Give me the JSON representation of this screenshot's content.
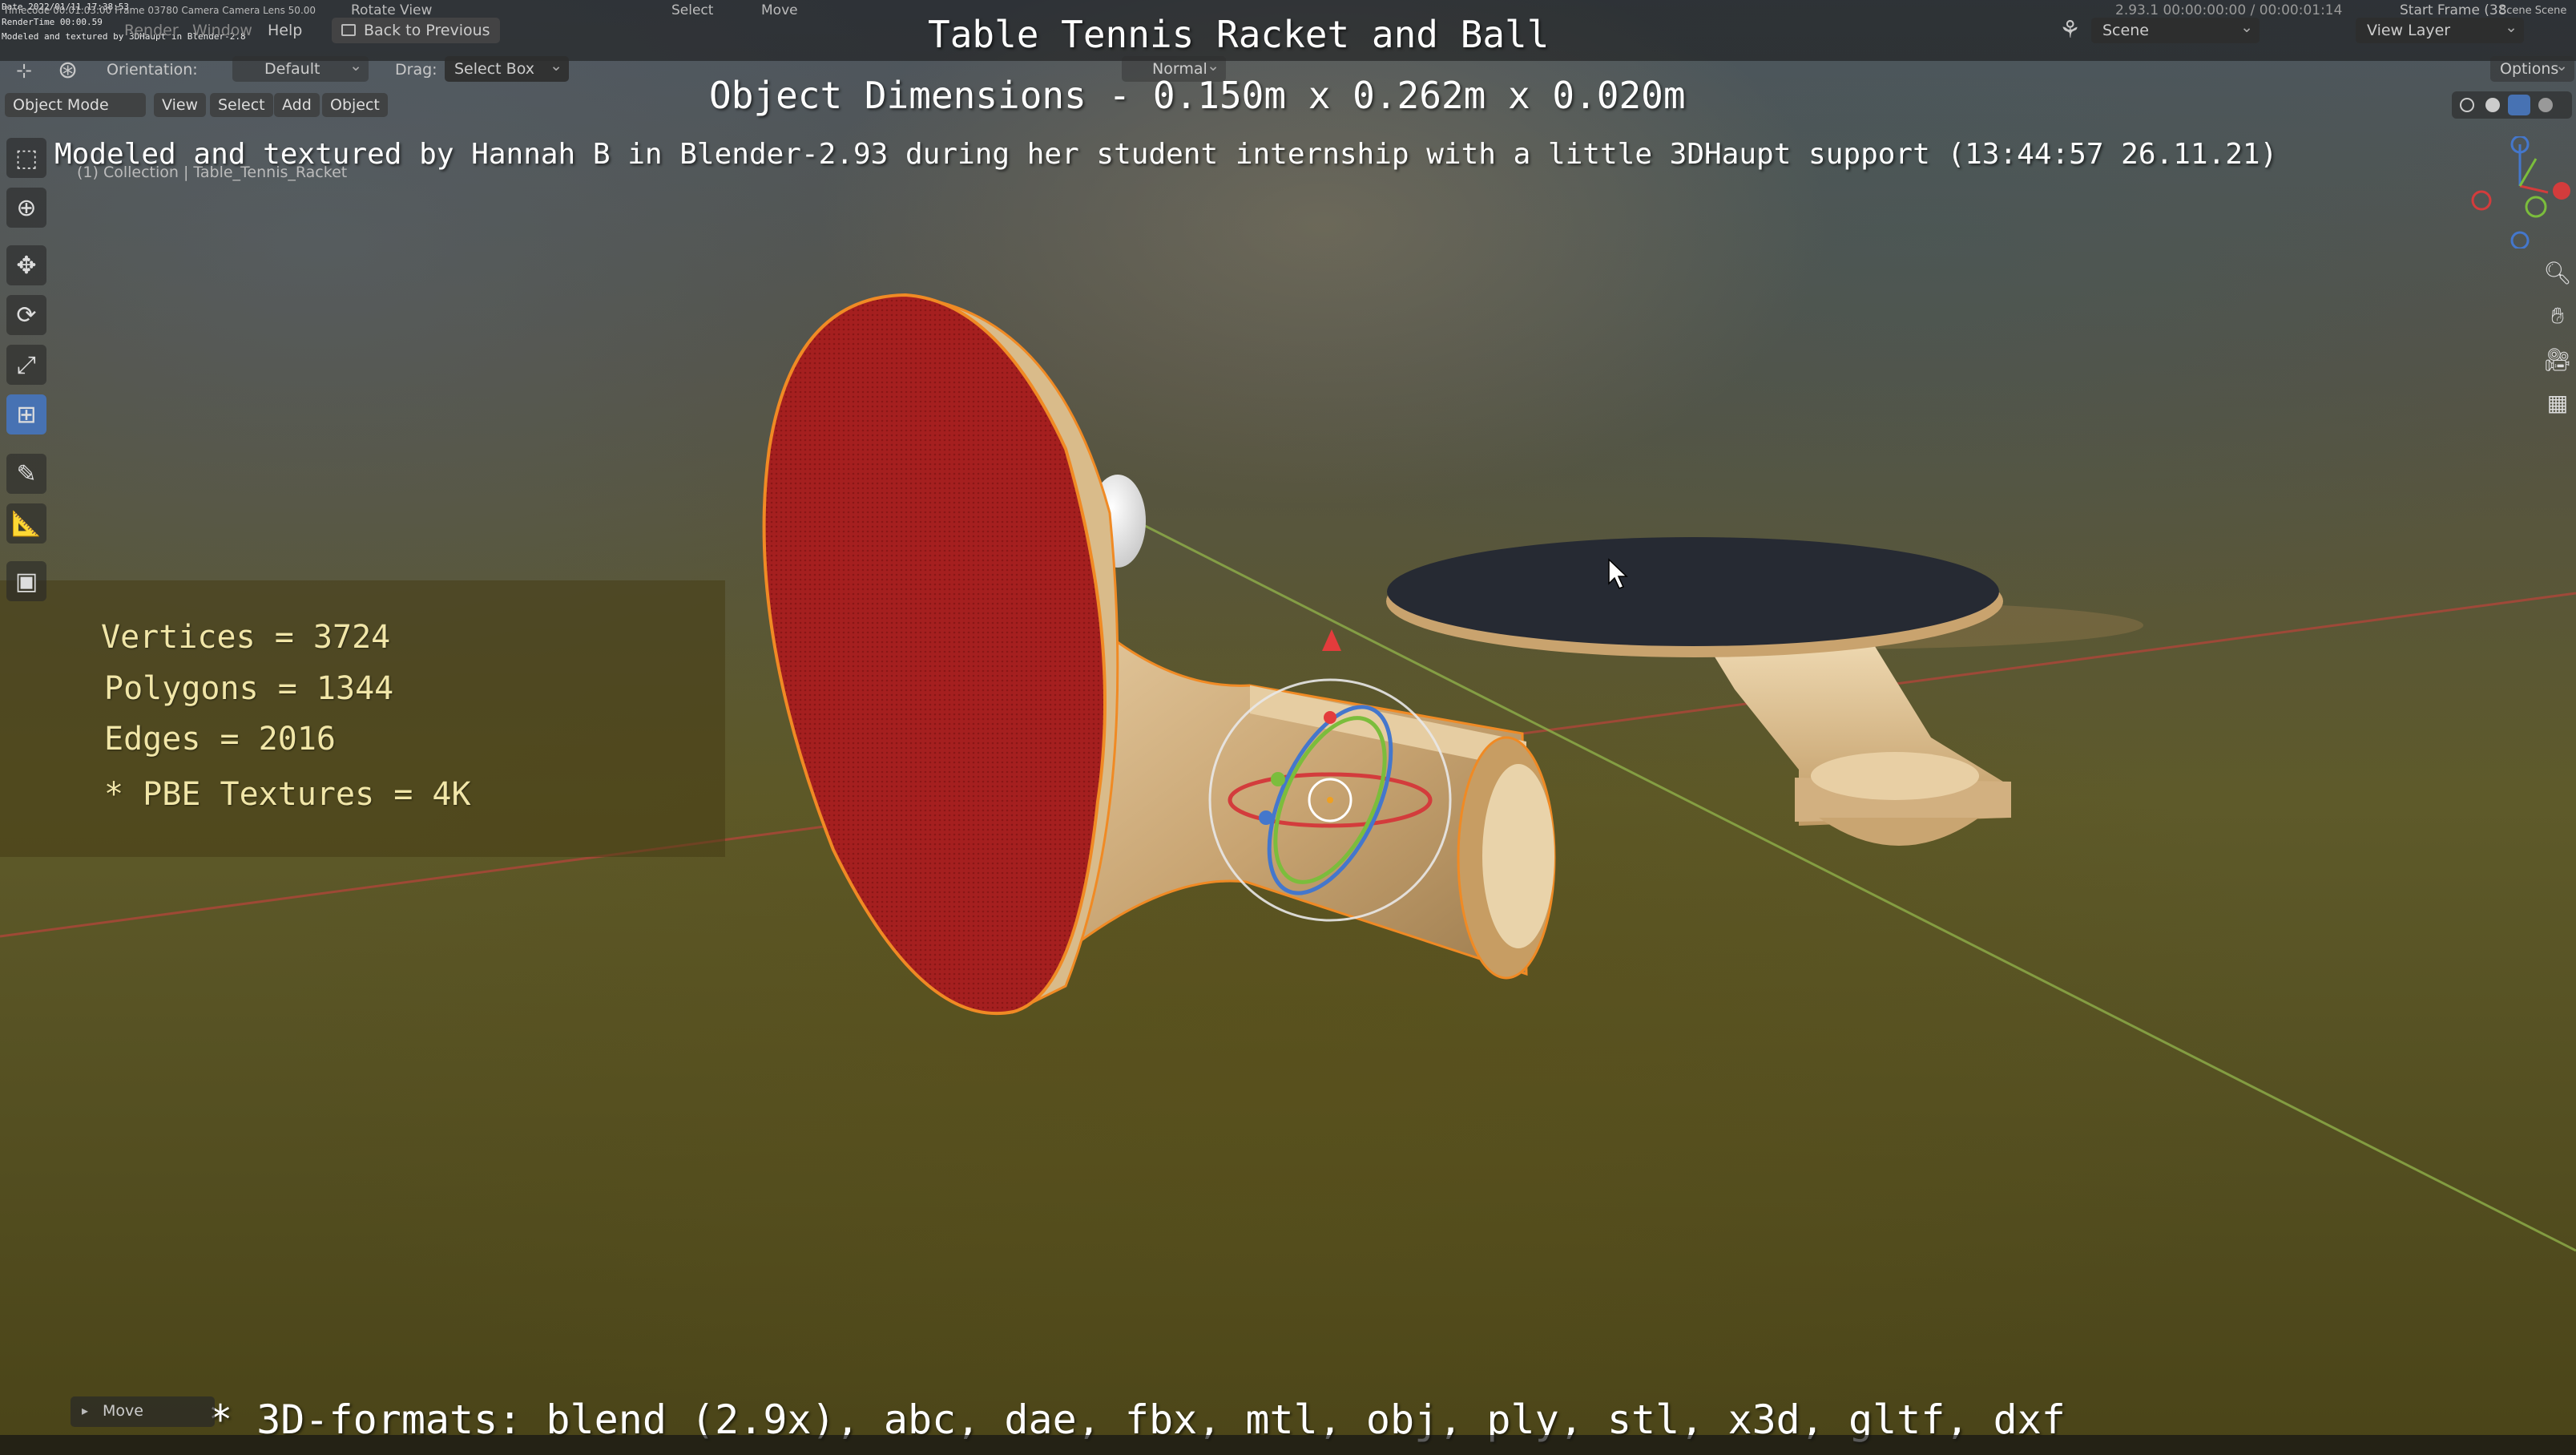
{
  "overlay": {
    "title": "Table Tennis Racket and Ball",
    "dimensions": "Object Dimensions -  0.150m x 0.262m x 0.020m",
    "credit": "Modeled and textured by Hannah B in Blender-2.93 during her student internship with a little 3DHaupt support (13:44:57 26.11.21)",
    "formats": "* 3D-formats: blend (2.9x), abc, dae, fbx, mtl, obj, ply, stl, x3d, gltf, dxf"
  },
  "stats": {
    "vertices": "Vertices = 3724",
    "polygons": "Polygons = 1344",
    "edges": "Edges = 2016",
    "textures": "* PBE Textures = 4K"
  },
  "stamp": {
    "date": "Date 2022/01/11 17:38:53",
    "render_time": "RenderTime 00:00.59",
    "modeled": "Modeled and textured by 3DHaupt in Blender-2.8"
  },
  "menu": {
    "render": "Render",
    "window": "Window",
    "help": "Help",
    "back": "Back to Previous",
    "scene": "Scene",
    "view_layer": "View Layer"
  },
  "tool_header": {
    "orientation_label": "Orientation:",
    "orientation_value": "Default",
    "drag_label": "Drag:",
    "drag_value": "Select Box",
    "pivot": "Normal",
    "options": "Options"
  },
  "mode_row": {
    "mode": "Object Mode",
    "view": "View",
    "select": "Select",
    "add": "Add",
    "object": "Object"
  },
  "viewport_info": "(1) Collection | Table_Tennis_Racket",
  "last_op": "Move",
  "statusbar": {
    "left": "Timecode 00:01:03:00   Frame 03780   Camera Camera   Lens 50.00",
    "rotate": "Rotate View",
    "select": "Select",
    "move": "Move",
    "version": "2.93.1  00:00:00:00 / 00:00:01:14",
    "start_frame": "Start Frame (38",
    "scene": "Scene  Scene"
  },
  "colors": {
    "rubber_red": "#a51f1f",
    "rubber_black": "#262a33",
    "wood": "#d8b98a",
    "selection_outline": "#f08a24",
    "stats_text": "#f1e6a8",
    "active_tool": "#4772b3"
  },
  "icons": [
    "select-box-icon",
    "cursor-icon",
    "move-icon",
    "rotate-icon",
    "scale-icon",
    "transform-icon",
    "annotate-icon",
    "measure-icon",
    "add-cube-icon",
    "zoom-icon",
    "hand-pan-icon",
    "camera-icon",
    "grid-icon",
    "mouse-pointer-icon"
  ]
}
